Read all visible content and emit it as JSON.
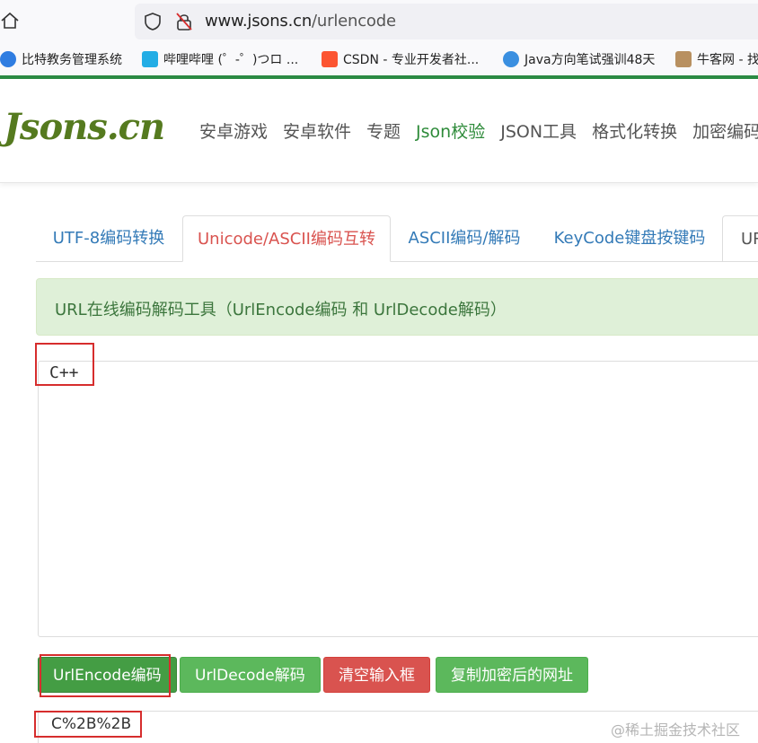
{
  "browser": {
    "url_host": "www.jsons.cn",
    "url_path": "/urlencode",
    "bookmarks": [
      {
        "label": "比特教务管理系统",
        "icon": "bitejiaowu-icon",
        "color": "#2f7de1"
      },
      {
        "label": "哔哩哔哩 (゜-゜)つロ ...",
        "icon": "bilibili-icon",
        "color": "#23ade5"
      },
      {
        "label": "CSDN - 专业开发者社...",
        "icon": "csdn-icon",
        "color": "#fc5531"
      },
      {
        "label": "Java方向笔试强训48天",
        "icon": "java-icon",
        "color": "#3a8fe0"
      },
      {
        "label": "牛客网 - 找",
        "icon": "nowcoder-icon",
        "color": "#b89060"
      }
    ]
  },
  "site": {
    "logo": "Jsons.cn",
    "nav": [
      "安卓游戏",
      "安卓软件",
      "专题",
      "Json校验",
      "JSON工具",
      "格式化转换",
      "加密编码"
    ],
    "nav_active_index": 3
  },
  "tabs": [
    {
      "label": "UTF-8编码转换"
    },
    {
      "label": "Unicode/ASCII编码互转",
      "active": true
    },
    {
      "label": "ASCII编码/解码"
    },
    {
      "label": "KeyCode键盘按键码"
    },
    {
      "label": "URL"
    }
  ],
  "alert": {
    "text": "URL在线编码解码工具（UrlEncode编码 和 UrlDecode解码）"
  },
  "input": {
    "value": "C++"
  },
  "buttons": {
    "encode": "UrlEncode编码",
    "decode": "UrlDecode解码",
    "clear": "清空输入框",
    "copy": "复制加密后的网址"
  },
  "output": {
    "value": "C%2B%2B"
  },
  "watermark": "@稀土掘金技术社区",
  "colors": {
    "accent_green": "#2e8b3a",
    "button_green": "#5cb85c",
    "button_red": "#d9534f",
    "highlight_red": "#d62d2d",
    "alert_bg": "#dff0d8"
  }
}
